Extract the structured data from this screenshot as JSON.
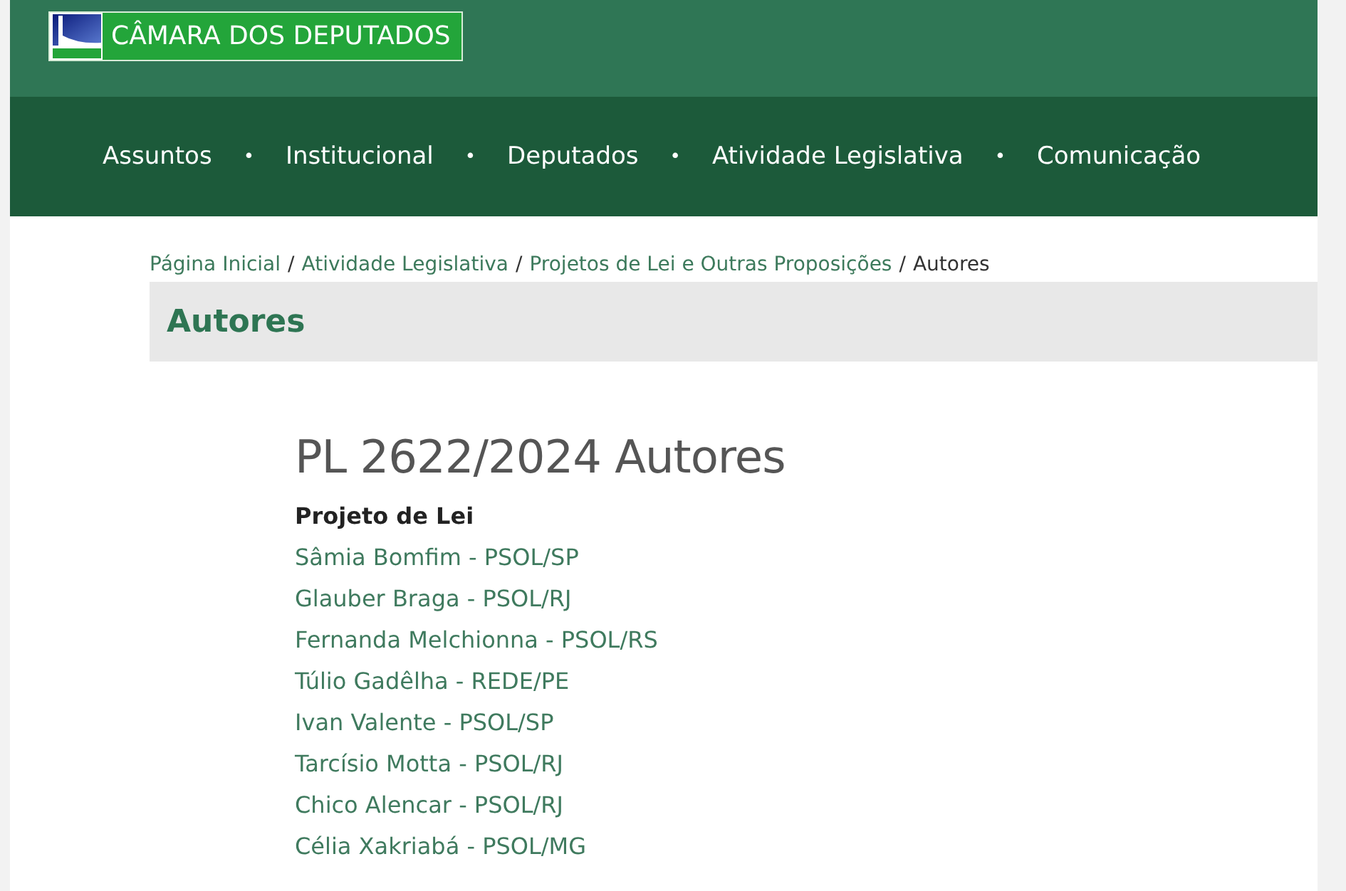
{
  "header": {
    "logo_text": "CÂMARA DOS DEPUTADOS"
  },
  "nav": {
    "items": [
      "Assuntos",
      "Institucional",
      "Deputados",
      "Atividade Legislativa",
      "Comunicação"
    ],
    "separator": "•"
  },
  "breadcrumb": {
    "separator": "/",
    "items": [
      {
        "label": "Página Inicial",
        "current": false
      },
      {
        "label": "Atividade Legislativa",
        "current": false
      },
      {
        "label": "Projetos de Lei e Outras Proposições",
        "current": false
      },
      {
        "label": "Autores",
        "current": true
      }
    ]
  },
  "page_title": "Autores",
  "heading": "PL 2622/2024 Autores",
  "subheading": "Projeto de Lei",
  "authors": [
    "Sâmia Bomfim - PSOL/SP",
    "Glauber Braga - PSOL/RJ",
    "Fernanda Melchionna - PSOL/RS",
    "Túlio Gadêlha - REDE/PE",
    "Ivan Valente - PSOL/SP",
    "Tarcísio Motta - PSOL/RJ",
    "Chico Alencar - PSOL/RJ",
    "Célia Xakriabá - PSOL/MG"
  ]
}
